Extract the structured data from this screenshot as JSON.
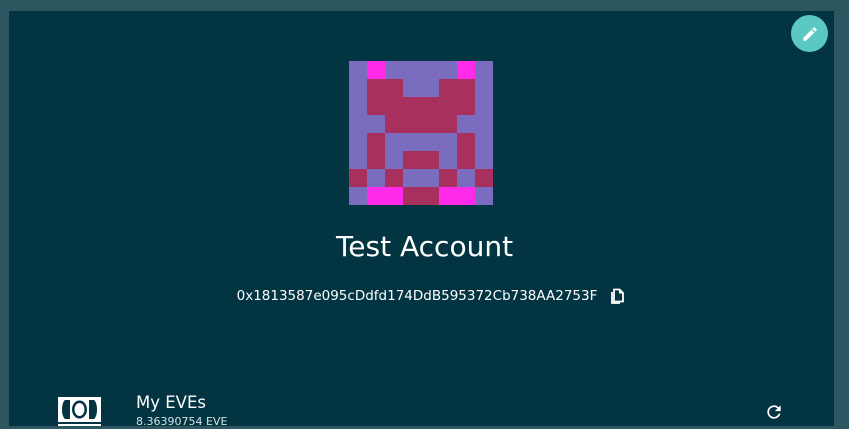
{
  "account": {
    "name": "Test Account",
    "address": "0x1813587e095cDdfd174DdB595372Cb738AA2753F"
  },
  "colors": {
    "page_bg": "#2c5660",
    "card_bg": "#033442",
    "accent": "#5cc8c3",
    "identicon_bg": "#7a6cbf",
    "identicon_main": "#a8305f",
    "identicon_highlight": "#ff2be8"
  },
  "icons": {
    "edit": "pencil-icon",
    "copy": "copy-icon",
    "money": "banknote-icon",
    "refresh": "refresh-icon"
  },
  "tokens": [
    {
      "name": "My EVEs",
      "balance": "8.36390754 EVE"
    }
  ]
}
